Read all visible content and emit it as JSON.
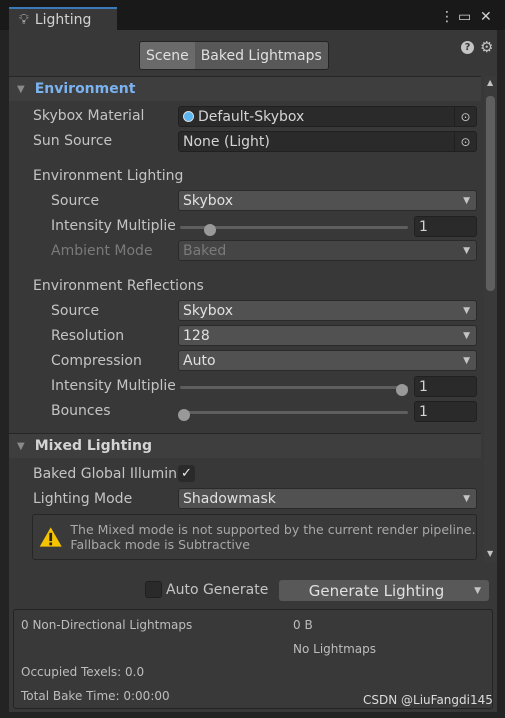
{
  "window": {
    "title": "Lighting",
    "icon": "lightbulb-icon"
  },
  "tabs": [
    {
      "label": "Scene",
      "active": true
    },
    {
      "label": "Baked Lightmaps",
      "active": false
    }
  ],
  "environment": {
    "header": "Environment",
    "skybox_label": "Skybox Material",
    "skybox_value": "Default-Skybox",
    "sun_label": "Sun Source",
    "sun_value": "None (Light)",
    "env_lighting": {
      "title": "Environment Lighting",
      "source_label": "Source",
      "source_value": "Skybox",
      "intensity_label": "Intensity Multiplier",
      "intensity_value": "1",
      "intensity_fraction": 0.125,
      "ambient_label": "Ambient Mode",
      "ambient_value": "Baked"
    },
    "env_reflections": {
      "title": "Environment Reflections",
      "source_label": "Source",
      "source_value": "Skybox",
      "resolution_label": "Resolution",
      "resolution_value": "128",
      "compression_label": "Compression",
      "compression_value": "Auto",
      "intensity_label": "Intensity Multiplier",
      "intensity_value": "1",
      "intensity_fraction": 1,
      "bounces_label": "Bounces",
      "bounces_value": "1",
      "bounces_fraction": 0
    }
  },
  "mixed": {
    "header": "Mixed Lighting",
    "baked_gi_label": "Baked Global Illumination",
    "baked_gi_checked": true,
    "mode_label": "Lighting Mode",
    "mode_value": "Shadowmask",
    "warning": "The Mixed mode is not supported by the current render pipeline. Fallback mode is Subtractive"
  },
  "footer": {
    "auto_generate_label": "Auto Generate",
    "auto_generate_checked": false,
    "generate_label": "Generate Lighting"
  },
  "stats": {
    "lightmaps": "0 Non-Directional Lightmaps",
    "size": "0 B",
    "no_lightmaps": "No Lightmaps",
    "texels": "Occupied Texels: 0.0",
    "bake_time": "Total Bake Time: 0:00:00"
  },
  "watermark": "CSDN @LiuFangdi145",
  "colors": {
    "accent": "#7bb2f0",
    "tab_highlight": "#3a79bb",
    "warning": "#f5c400"
  }
}
